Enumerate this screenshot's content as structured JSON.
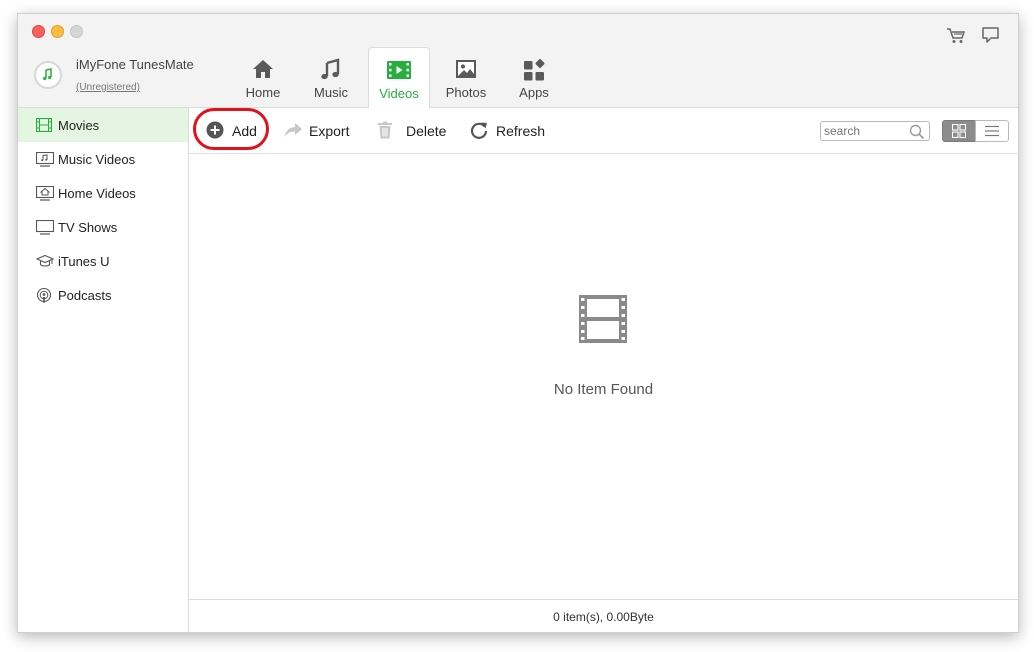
{
  "app": {
    "name": "iMyFone TunesMate",
    "registration": "(Unregistered)"
  },
  "tabs": [
    {
      "label": "Home",
      "icon": "home-icon"
    },
    {
      "label": "Music",
      "icon": "music-note-icon"
    },
    {
      "label": "Videos",
      "icon": "film-icon",
      "active": true
    },
    {
      "label": "Photos",
      "icon": "picture-icon"
    },
    {
      "label": "Apps",
      "icon": "apps-grid-icon"
    }
  ],
  "sidebar": {
    "items": [
      {
        "label": "Movies",
        "icon": "film-strip-icon",
        "active": true
      },
      {
        "label": "Music Videos",
        "icon": "music-video-icon"
      },
      {
        "label": "Home Videos",
        "icon": "home-video-icon"
      },
      {
        "label": "TV Shows",
        "icon": "tv-icon"
      },
      {
        "label": "iTunes U",
        "icon": "graduation-cap-icon"
      },
      {
        "label": "Podcasts",
        "icon": "podcast-icon"
      }
    ]
  },
  "toolbar": {
    "add_label": "Add",
    "export_label": "Export",
    "delete_label": "Delete",
    "refresh_label": "Refresh",
    "search_placeholder": "search"
  },
  "content": {
    "empty_message": "No Item Found"
  },
  "status": {
    "summary": "0 item(s), 0.00Byte"
  },
  "colors": {
    "accent_green": "#27ae3c",
    "highlight_red": "#e0131c",
    "sidebar_active_bg": "#e4f5e2"
  }
}
